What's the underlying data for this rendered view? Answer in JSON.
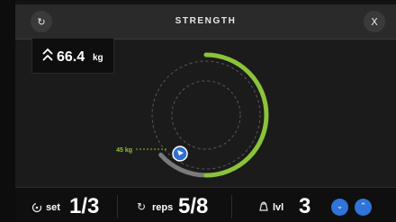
{
  "header": {
    "title": "STRENGTH",
    "reset_icon": "↻",
    "close_label": "X"
  },
  "weight": {
    "value": "66.4",
    "unit": "kg"
  },
  "dial": {
    "marker_label": "45 kg",
    "progress_fraction": 0.5,
    "colors": {
      "progress": "#8bc33a",
      "track": "#7a7a7a",
      "guide": "#5a5a5a",
      "marker": "#2f6fd0"
    }
  },
  "footer": {
    "set": {
      "label": "set",
      "value": "1/3"
    },
    "reps": {
      "label": "reps",
      "value": "5/8"
    },
    "level": {
      "label": "lvl",
      "value": "3"
    },
    "level_down_icon": "⌄",
    "level_up_icon": "⌃"
  }
}
